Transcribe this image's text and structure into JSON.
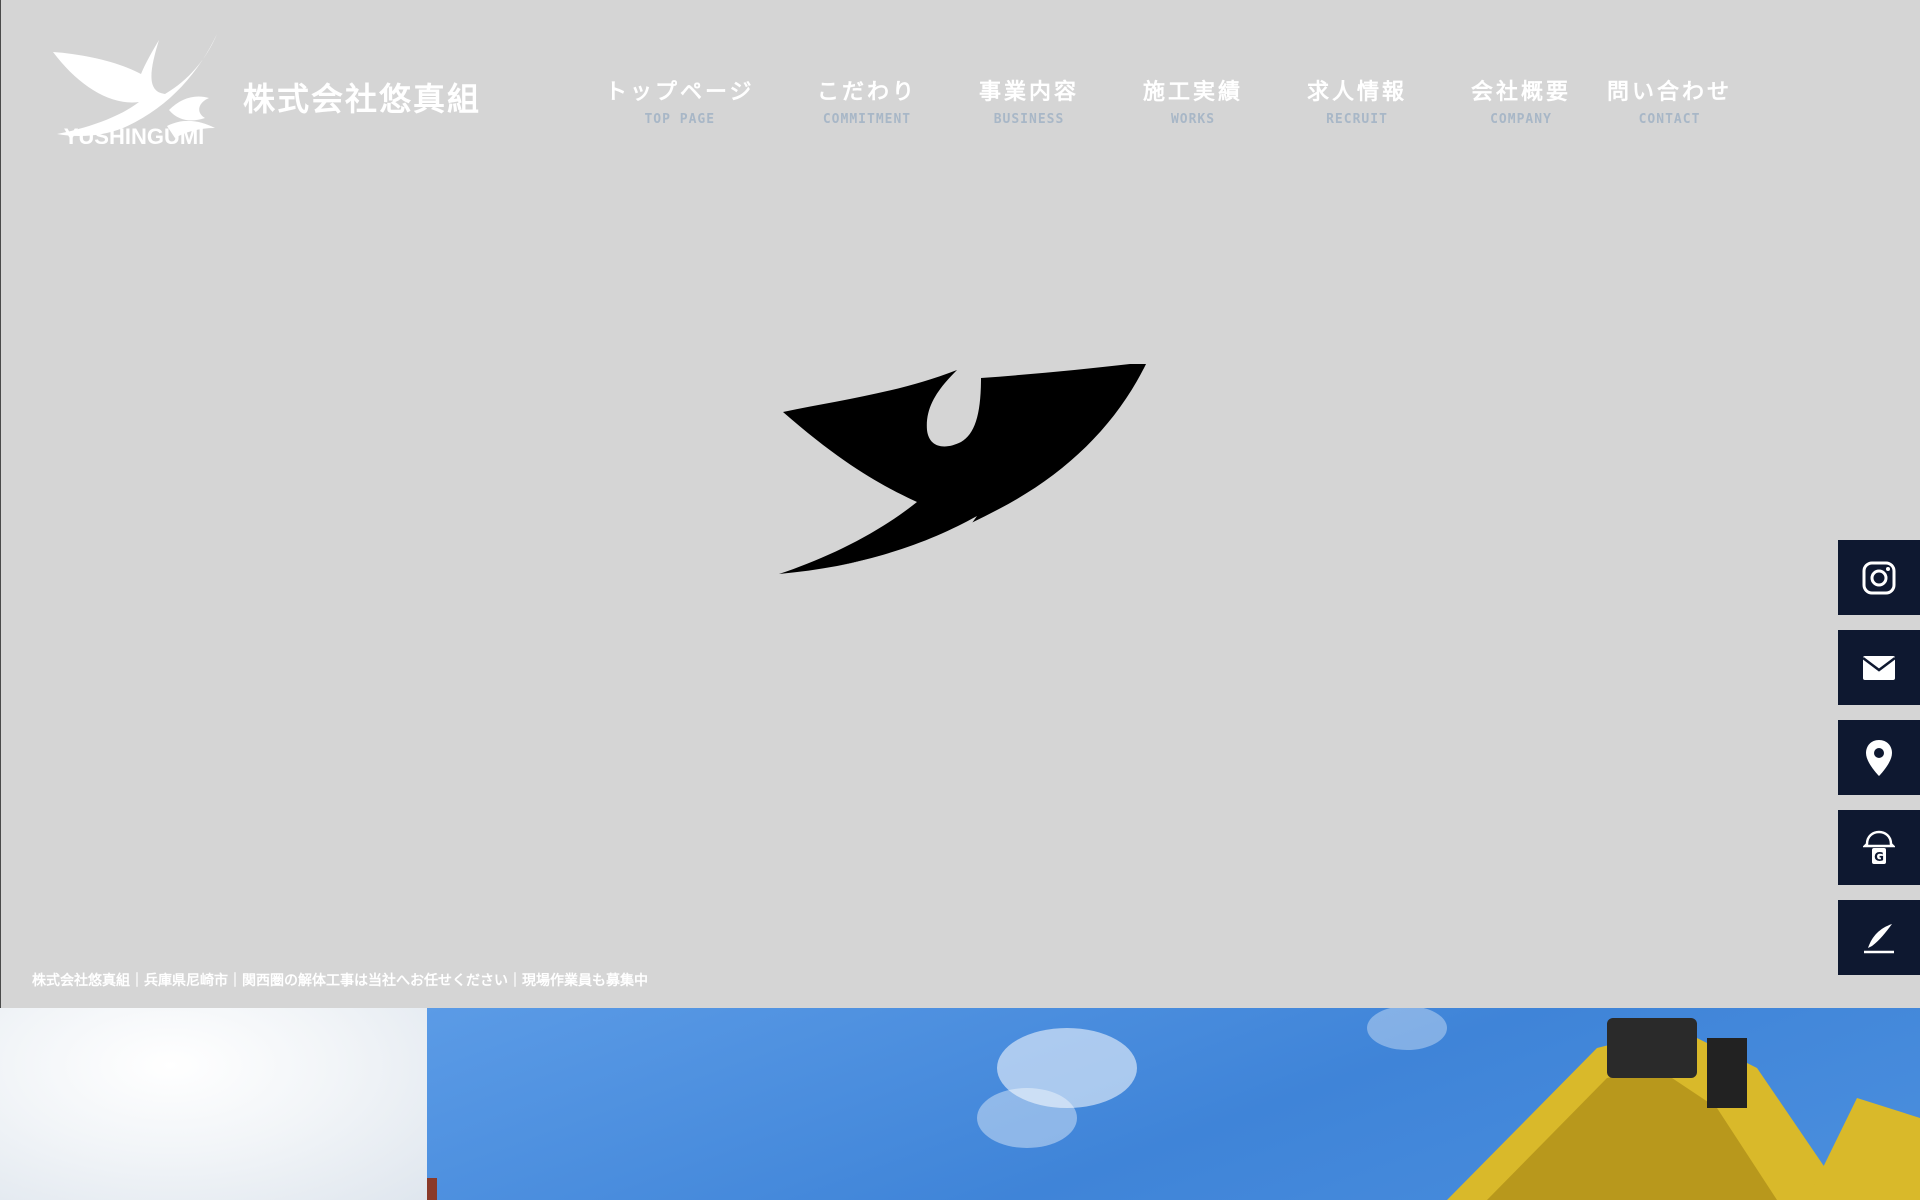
{
  "company": {
    "name": "株式会社悠真組",
    "wordmark": "YUSHINGUMI"
  },
  "nav": [
    {
      "jp": "トップページ",
      "en": "TOP PAGE"
    },
    {
      "jp": "こだわり",
      "en": "COMMITMENT"
    },
    {
      "jp": "事業内容",
      "en": "BUSINESS"
    },
    {
      "jp": "施工実績",
      "en": "WORKS"
    },
    {
      "jp": "求人情報",
      "en": "RECRUIT"
    },
    {
      "jp": "会社概要",
      "en": "COMPANY"
    },
    {
      "jp": "問い合わせ",
      "en": "CONTACT"
    }
  ],
  "hero": {
    "tagline": "株式会社悠真組｜兵庫県尼崎市｜関西圏の解体工事は当社へお任せください｜現場作業員も募集中"
  },
  "side_buttons": [
    "instagram-icon",
    "mail-icon",
    "map-pin-icon",
    "helmet-icon",
    "pen-icon"
  ],
  "colors": {
    "hero_bg": "#d5d5d5",
    "side_button_bg": "#0e1830",
    "nav_en": "#a8b7c7",
    "sky": "#4a8ddd"
  }
}
